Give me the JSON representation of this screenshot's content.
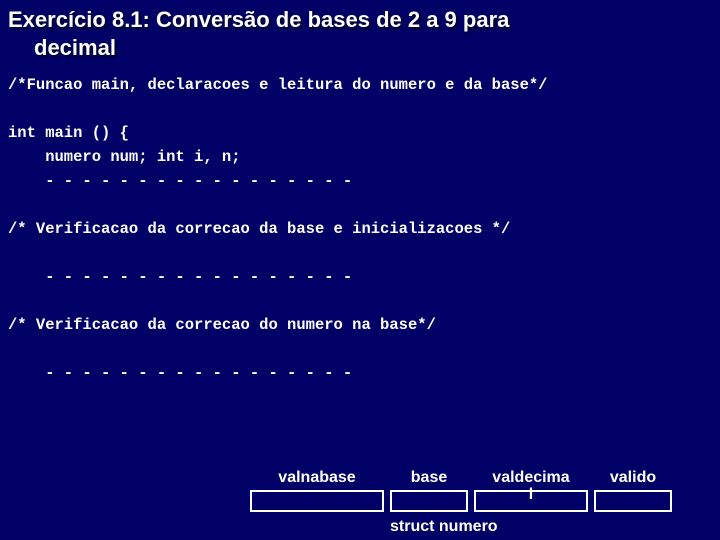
{
  "title": {
    "line1": "Exercício 8.1: Conversão de bases de 2 a 9 para",
    "line2": "decimal"
  },
  "code": {
    "l1": "/*Funcao main, declaracoes e leitura do numero e da base*/",
    "l2": "int main () {",
    "l3": "    numero num; int i, n;",
    "l4": "    - - - - - - - - - - - - - - - - -",
    "l5": "/* Verificacao da correcao da base e inicializacoes */",
    "l6": "    - - - - - - - - - - - - - - - - -",
    "l7": "/* Verificacao da correcao do numero na base*/",
    "l8": "    - - - - - - - - - - - - - - - - -"
  },
  "fields": {
    "f1": "valnabase",
    "f2": "base",
    "f3a": "valdecima",
    "f3b": "l",
    "f4": "valido"
  },
  "caption": "struct numero"
}
